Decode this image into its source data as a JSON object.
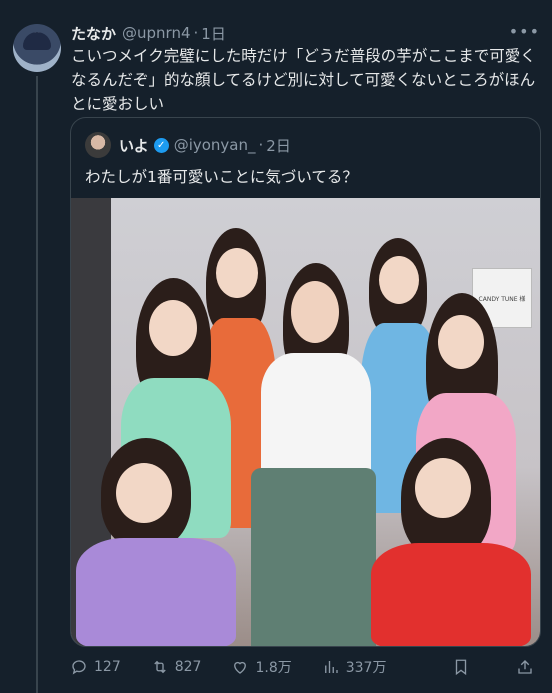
{
  "tweet": {
    "name": "たなか",
    "handle": "@upnrn4",
    "separator": "·",
    "time": "1日",
    "text": "こいつメイク完璧にした時だけ「どうだ普段の芋がここまで可愛くなるんだぞ」的な顔してるけど別に対して可愛くないところがほんとに愛おしい",
    "more_icon": "more-horizontal-icon"
  },
  "quote": {
    "name": "いよ",
    "handle": "@iyonyan_",
    "separator": "·",
    "time": "2日",
    "text": "わたしが1番可愛いことに気づいてる？",
    "verified_icon": "verified-badge-icon",
    "photo_sign": "CANDY TUNE 様"
  },
  "actions": {
    "replies": "127",
    "retweets": "827",
    "likes": "1.8万",
    "views": "337万"
  },
  "colors": {
    "background": "#15202b",
    "border": "#38444d",
    "text_secondary": "#8b98a5",
    "accent": "#1d9bf0"
  }
}
